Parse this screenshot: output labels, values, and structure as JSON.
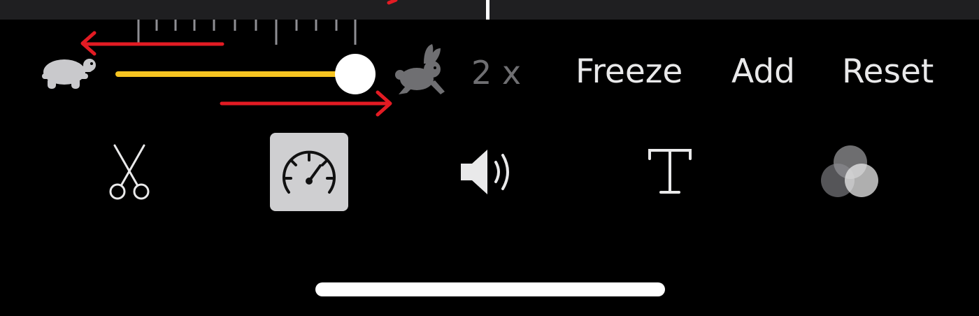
{
  "colors": {
    "background": "#000000",
    "timeline": "#1f1f21",
    "slider_fill": "#f6c421",
    "annotation_red": "#e31b23",
    "tool_active_bg": "#cfcfd1"
  },
  "speed": {
    "slow_icon": "turtle-icon",
    "fast_icon": "rabbit-icon",
    "slider_level": 1.0,
    "value_label": "2 x"
  },
  "actions": {
    "freeze": "Freeze",
    "add": "Add",
    "reset": "Reset"
  },
  "toolbar": {
    "tools": [
      {
        "icon": "scissors-icon",
        "active": false
      },
      {
        "icon": "speedometer-icon",
        "active": true
      },
      {
        "icon": "volume-icon",
        "active": false
      },
      {
        "icon": "text-icon",
        "active": false
      },
      {
        "icon": "filters-icon",
        "active": false
      }
    ]
  }
}
